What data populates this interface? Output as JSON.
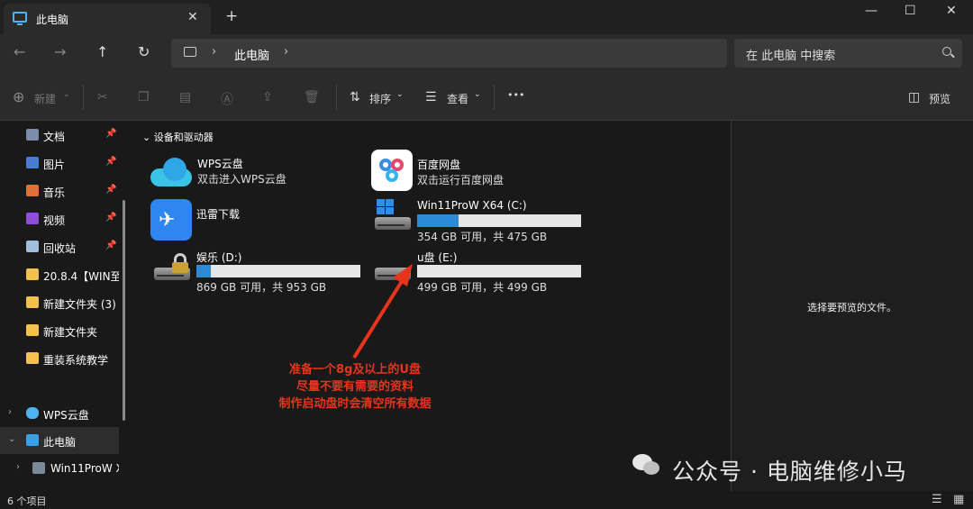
{
  "window": {
    "tab_title": "此电脑",
    "tab_close": "✕",
    "new_tab": "+",
    "controls": {
      "minimize": "—",
      "maximize": "☐",
      "close": "✕"
    }
  },
  "nav": {
    "back": "←",
    "forward": "→",
    "up": "↑",
    "refresh": "↻",
    "breadcrumb": "此电脑",
    "chevron": "›",
    "search_placeholder": "在 此电脑 中搜索"
  },
  "toolbar": {
    "new_label": "新建",
    "sort_label": "排序",
    "view_label": "查看",
    "more": "•••",
    "preview_label": "预览"
  },
  "sidebar": {
    "quick": [
      {
        "label": "文档",
        "icon": "documents-icon",
        "pin": true,
        "color": "#7b8cab"
      },
      {
        "label": "图片",
        "icon": "pictures-icon",
        "pin": true,
        "color": "#4a7bd3"
      },
      {
        "label": "音乐",
        "icon": "music-icon",
        "pin": true,
        "color": "#e26f3b"
      },
      {
        "label": "视频",
        "icon": "videos-icon",
        "pin": true,
        "color": "#8d4fd8"
      },
      {
        "label": "回收站",
        "icon": "recycle-bin-icon",
        "pin": true,
        "color": "#9fbfdc"
      },
      {
        "label": "20.8.4【WIN至",
        "icon": "folder-icon",
        "pin": false,
        "color": "#f2c14e"
      },
      {
        "label": "新建文件夹 (3)",
        "icon": "folder-icon",
        "pin": false,
        "color": "#f2c14e"
      },
      {
        "label": "新建文件夹",
        "icon": "folder-icon",
        "pin": false,
        "color": "#f2c14e"
      },
      {
        "label": "重装系统教学",
        "icon": "folder-icon",
        "pin": false,
        "color": "#f2c14e"
      }
    ],
    "tree": [
      {
        "label": "WPS云盘",
        "chevron": "›"
      },
      {
        "label": "此电脑",
        "chevron": "⌄"
      },
      {
        "label": "Win11ProW X",
        "chevron": "›"
      }
    ]
  },
  "content": {
    "group_label": "设备和驱动器",
    "group_chevron": "⌄",
    "items": [
      {
        "name": "WPS云盘",
        "sub": "双击进入WPS云盘"
      },
      {
        "name": "百度网盘",
        "sub": "双击运行百度网盘"
      },
      {
        "name": "迅雷下载"
      },
      {
        "name": "Win11ProW X64 (C:)",
        "sub": "354 GB 可用，共 475 GB",
        "used_fraction": 0.25
      },
      {
        "name": "娱乐 (D:)",
        "sub": "869 GB 可用，共 953 GB",
        "used_fraction": 0.09
      },
      {
        "name": "u盘 (E:)",
        "sub": "499 GB 可用，共 499 GB",
        "used_fraction": 0.0
      }
    ],
    "annotation": [
      "准备一个8g及以上的U盘",
      "尽量不要有需要的资料",
      "制作启动盘时会清空所有数据"
    ],
    "annotation_color": "#e8341c"
  },
  "preview": {
    "message": "选择要预览的文件。"
  },
  "status": {
    "count": "6 个项目"
  },
  "watermark": {
    "text": "公众号 · 电脑维修小马"
  }
}
